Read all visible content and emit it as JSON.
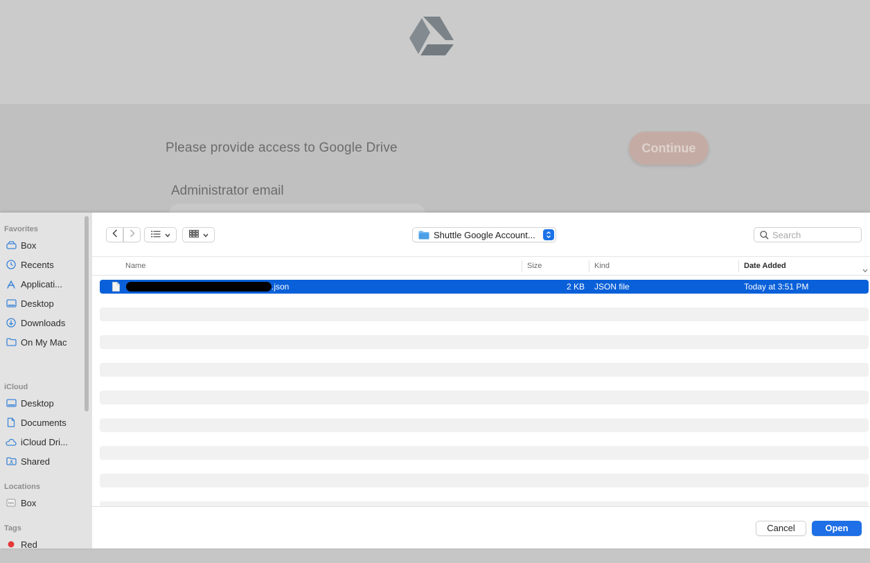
{
  "background_page": {
    "prompt_text": "Please provide access to Google Drive",
    "continue_label": "Continue",
    "admin_email_label": "Administrator email"
  },
  "sidebar": {
    "sections": [
      {
        "title": "Favorites",
        "items": [
          {
            "label": "Box",
            "icon": "drive-icon"
          },
          {
            "label": "Recents",
            "icon": "clock-icon"
          },
          {
            "label": "Applicati...",
            "icon": "applications-icon"
          },
          {
            "label": "Desktop",
            "icon": "desktop-icon"
          },
          {
            "label": "Downloads",
            "icon": "download-icon"
          },
          {
            "label": "On My Mac",
            "icon": "folder-icon"
          }
        ]
      },
      {
        "title": "iCloud",
        "items": [
          {
            "label": "Desktop",
            "icon": "desktop-icon"
          },
          {
            "label": "Documents",
            "icon": "document-icon"
          },
          {
            "label": "iCloud Dri...",
            "icon": "cloud-icon"
          },
          {
            "label": "Shared",
            "icon": "shared-folder-icon"
          }
        ]
      },
      {
        "title": "Locations",
        "items": [
          {
            "label": "Box",
            "icon": "box-disk-icon"
          }
        ]
      },
      {
        "title": "Tags",
        "items": [
          {
            "label": "Red",
            "icon": "red-tag-dot",
            "color": "#e5393a"
          }
        ]
      }
    ]
  },
  "toolbar": {
    "location": "Shuttle Google Account...",
    "search_placeholder": "Search"
  },
  "columns": {
    "name": "Name",
    "size": "Size",
    "kind": "Kind",
    "date_added": "Date Added"
  },
  "files": [
    {
      "name_suffix": ".json",
      "size": "2 KB",
      "kind": "JSON file",
      "date_added": "Today at 3:51 PM",
      "selected": true
    }
  ],
  "footer": {
    "cancel_label": "Cancel",
    "open_label": "Open"
  },
  "colors": {
    "selection": "#0a60d9",
    "open_button": "#1f6fe6",
    "continue_button": "#c4aca5",
    "tag_red": "#e5393a"
  }
}
